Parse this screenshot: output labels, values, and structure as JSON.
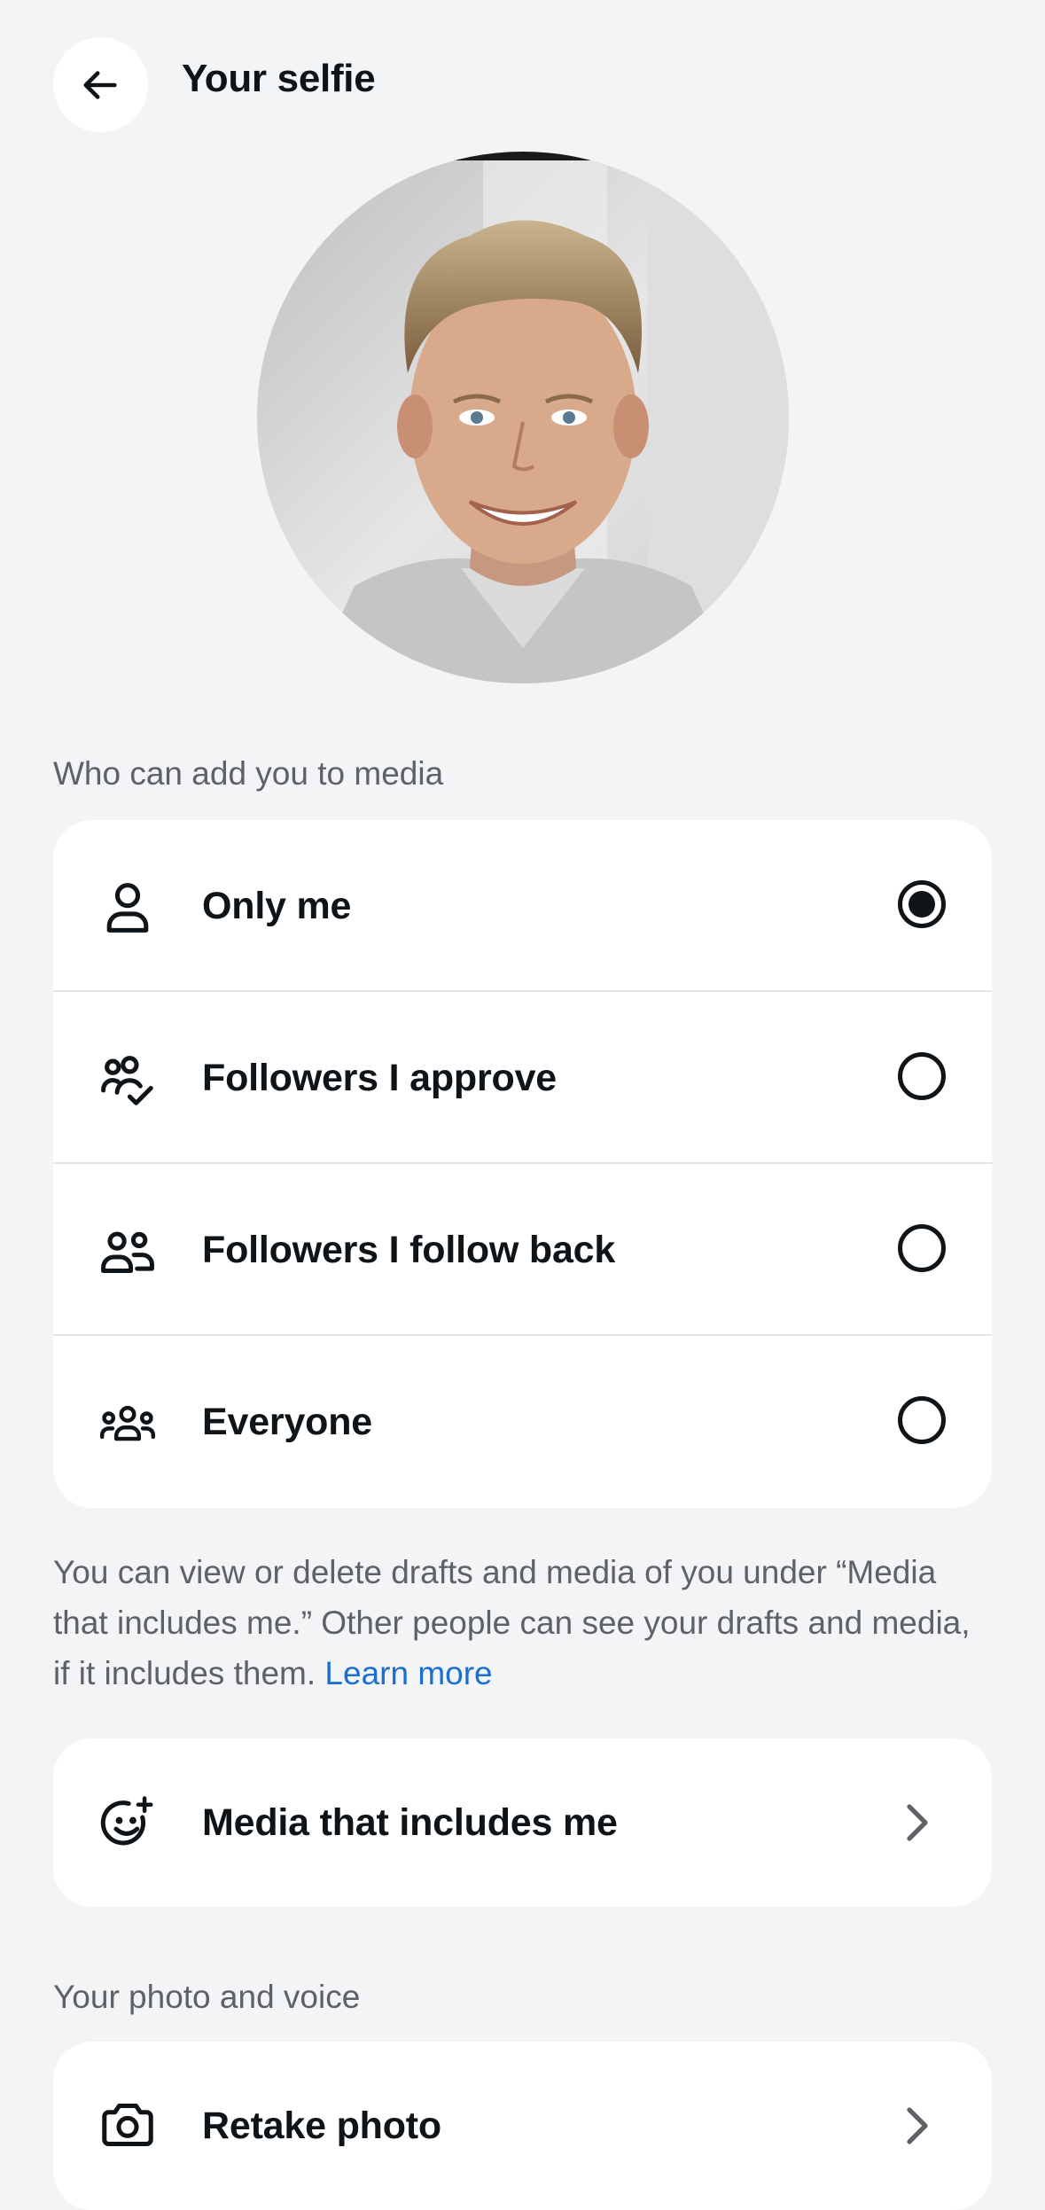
{
  "header": {
    "title": "Your selfie",
    "back_icon": "arrow-left-icon"
  },
  "selfie": {
    "description_icon": "selfie-photo"
  },
  "audience_section": {
    "label": "Who can add you to media",
    "options": [
      {
        "label": "Only me",
        "icon": "person-icon",
        "selected": true
      },
      {
        "label": "Followers I approve",
        "icon": "people-check-icon",
        "selected": false
      },
      {
        "label": "Followers I follow back",
        "icon": "two-people-icon",
        "selected": false
      },
      {
        "label": "Everyone",
        "icon": "group-icon",
        "selected": false
      }
    ]
  },
  "info": {
    "text": "You can view or delete drafts and media of you under “Media that includes me.” Other people can see your drafts and media, if it includes them.",
    "link": "Learn more"
  },
  "media_link": {
    "label": "Media that includes me",
    "icon": "smiley-sparkle-icon"
  },
  "photo_voice_section": {
    "label": "Your photo and voice",
    "items": [
      {
        "label": "Retake photo",
        "icon": "camera-icon"
      }
    ]
  },
  "colors": {
    "background": "#f3f4f6",
    "card": "#ffffff",
    "text": "#0f1419",
    "secondary_text": "#5e6166",
    "link": "#1a6fd1"
  }
}
